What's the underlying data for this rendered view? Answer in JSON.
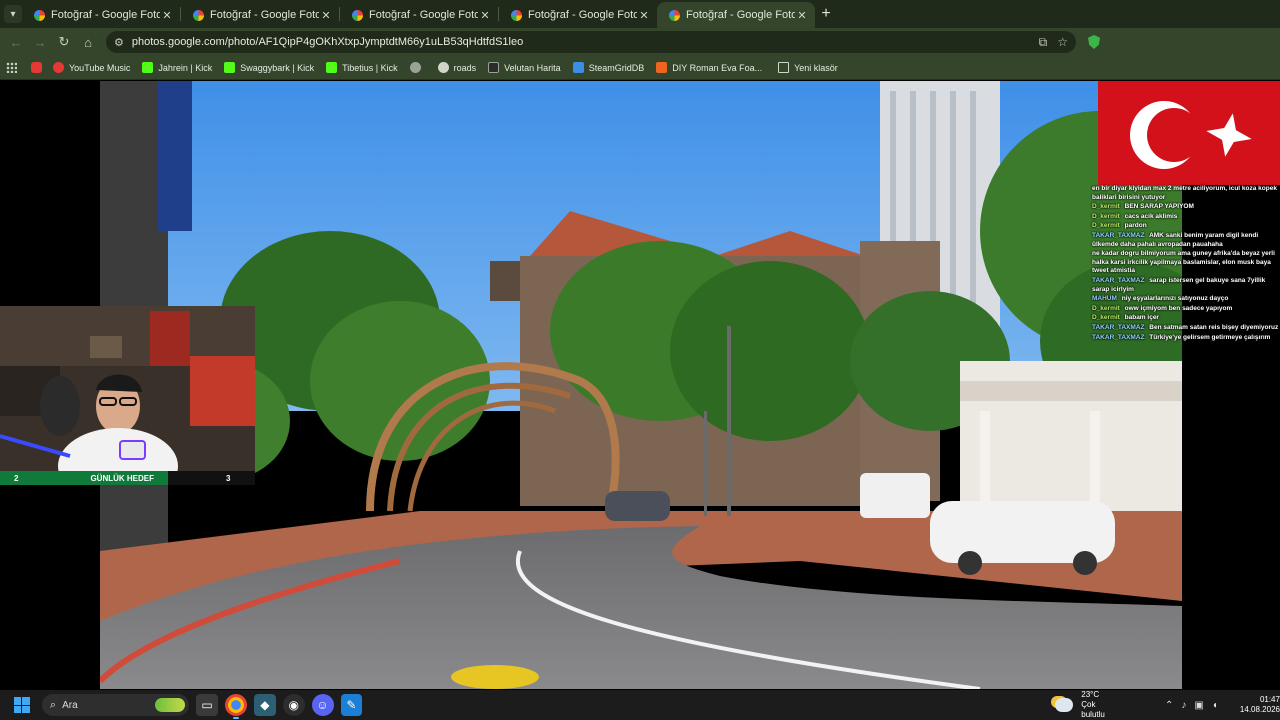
{
  "browser": {
    "tabs": [
      {
        "title": "Fotoğraf - Google Fotoğraflar",
        "close": "✕"
      },
      {
        "title": "Fotoğraf - Google Fotoğraflar",
        "close": "✕"
      },
      {
        "title": "Fotoğraf - Google Fotoğraflar",
        "close": "✕"
      },
      {
        "title": "Fotoğraf - Google Fotoğraflar",
        "close": "✕"
      },
      {
        "title": "Fotoğraf - Google Fotoğraflar",
        "close": "✕"
      }
    ],
    "new_tab": "+",
    "url": "photos.google.com/photo/AF1QipP4gOKhXtxpJymptdtM66y1uLB53qHdtfdS1leo",
    "bookmarks": [
      {
        "label": "YouTube Music",
        "icon": "youtube-music-icon",
        "color": "#e53935"
      },
      {
        "label": "Jahrein | Kick",
        "icon": "kick-icon",
        "color": "#53fc18"
      },
      {
        "label": "Swaggybark | Kick",
        "icon": "kick-icon",
        "color": "#53fc18"
      },
      {
        "label": "Tibetius | Kick",
        "icon": "kick-icon",
        "color": "#53fc18"
      },
      {
        "label": "",
        "icon": "globe-icon",
        "color": "#9aa394"
      },
      {
        "label": "roads",
        "icon": "roads-icon",
        "color": "#cfd6c8"
      },
      {
        "label": "Velutan Harita",
        "icon": "map-icon",
        "color": "#2b2b2b"
      },
      {
        "label": "SteamGridDB",
        "icon": "steamgriddb-icon",
        "color": "#3a8ee6"
      },
      {
        "label": "DIY Roman Eva Foa...",
        "icon": "etsy-icon",
        "color": "#f1641e"
      },
      {
        "label": "Yeni klasör",
        "icon": "folder-icon",
        "color": "#cfd6c8"
      }
    ]
  },
  "overlay": {
    "goal": {
      "left": "2",
      "label": "GÜNLÜK HEDEF",
      "right": "3",
      "progress_fraction": 0.66
    }
  },
  "chat": [
    {
      "user": "",
      "text": "en bir diyar kiyidan max 2 metre aciliyorum, icul koza kopek baliklari birisini yutuyor"
    },
    {
      "user": "D_kermit",
      "text": "BEN SARAP YAPIYOM"
    },
    {
      "user": "D_kermit",
      "text": "cacs acik aklimis"
    },
    {
      "user": "D_kermit",
      "text": "pardon"
    },
    {
      "user": "TAKAR_TAXMAZ",
      "text": "AMK sanki benim yaram digil kendi ülkemde daha pahalı avropadan pauahaha"
    },
    {
      "user": "",
      "text": "ne kadar dogru bilmiyorum ama guney afrika'da beyaz yerli halka karsi irkcilik yapilmaya baslamislar, elon musk baya tweet atmistia"
    },
    {
      "user": "TAKAR_TAXMAZ",
      "text": "sarap istersen gel bakuye sana 7yillik sarap icirlyim"
    },
    {
      "user": "MAHUM",
      "text": "niy eşyalarlarınızı satıyonuz dayço"
    },
    {
      "user": "D_kermit",
      "text": "oww içmiyom ben sadece yapıyom"
    },
    {
      "user": "D_kermit",
      "text": "babam içer"
    },
    {
      "user": "TAKAR_TAXMAZ",
      "text": "Ben satmam satan reis bişey diyemiyoruz"
    },
    {
      "user": "TAKAR_TAXMAZ",
      "text": "Türkiye'ye gelirsem getirmeye çalışırım"
    }
  ],
  "taskbar": {
    "search_placeholder": "Ara",
    "apps": [
      "file-explorer-icon",
      "chrome-icon",
      "app-icon",
      "obs-icon",
      "discord-icon",
      "paint-icon"
    ],
    "weather": {
      "temp": "23°C",
      "desc": "Çok bulutlu"
    },
    "time": "01:47",
    "date": "14.08.2026"
  },
  "colors": {
    "chrome_frame": "#34452c",
    "tabstrip": "#1f2a1a",
    "goal_fill": "#0f7a3a",
    "taskbar": "#1c1c1c"
  }
}
